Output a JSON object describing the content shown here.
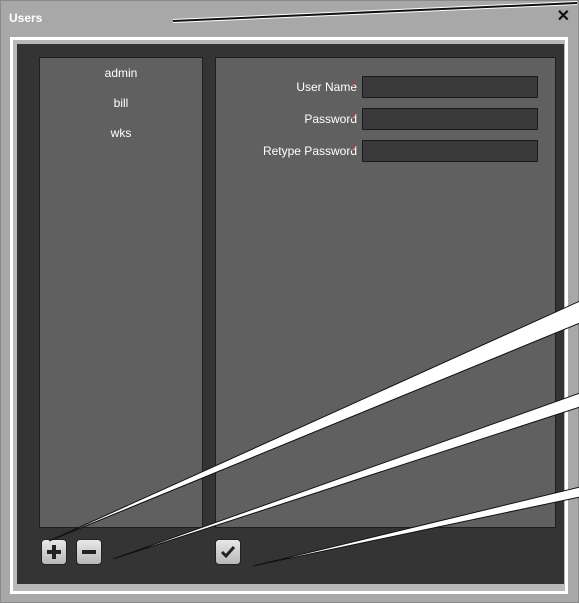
{
  "window": {
    "title": "Users",
    "close_icon": "close-icon"
  },
  "users": {
    "items": [
      {
        "label": "admin"
      },
      {
        "label": "bill"
      },
      {
        "label": "wks"
      }
    ]
  },
  "form": {
    "fields": [
      {
        "label": "User Name",
        "required_mark": "*",
        "value": ""
      },
      {
        "label": "Password",
        "required_mark": "*",
        "value": ""
      },
      {
        "label": "Retype Password",
        "required_mark": "*",
        "value": ""
      }
    ]
  },
  "toolbar": {
    "add_icon": "plus-icon",
    "remove_icon": "minus-icon",
    "apply_icon": "checkmark-icon"
  },
  "colors": {
    "panel": "#606060",
    "content_bg": "#343434",
    "required": "#c0322c"
  }
}
